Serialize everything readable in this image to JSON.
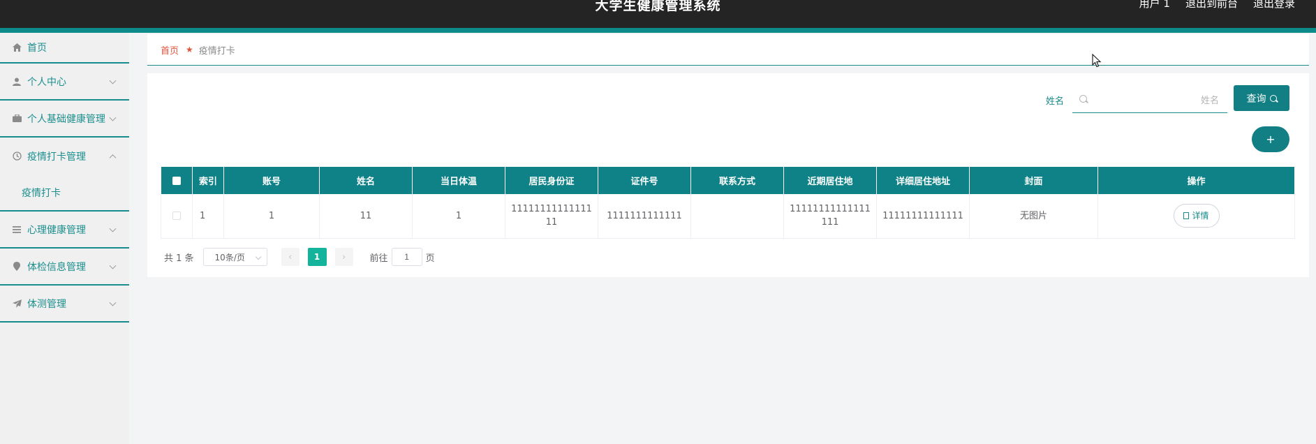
{
  "header": {
    "title": "大学生健康管理系统",
    "user_label": "用户 1",
    "front_link": "退出到前台",
    "logout_link": "退出登录"
  },
  "sidebar": {
    "items": [
      {
        "label": "首页",
        "icon": "home-icon"
      },
      {
        "label": "个人中心",
        "icon": "user-icon"
      },
      {
        "label": "个人基础健康管理",
        "icon": "briefcase-icon"
      },
      {
        "label": "疫情打卡管理",
        "icon": "clock-icon",
        "expanded": true,
        "children": [
          "疫情打卡"
        ]
      },
      {
        "label": "心理健康管理",
        "icon": "list-icon"
      },
      {
        "label": "体检信息管理",
        "icon": "location-icon"
      },
      {
        "label": "体测管理",
        "icon": "send-icon"
      }
    ]
  },
  "breadcrumb": {
    "home": "首页",
    "current": "疫情打卡"
  },
  "search": {
    "label": "姓名",
    "placeholder": "姓名",
    "query_label": "查询",
    "add_label": "+"
  },
  "table": {
    "columns": [
      "索引",
      "账号",
      "姓名",
      "当日体温",
      "居民身份证",
      "证件号",
      "联系方式",
      "近期居住地",
      "详细居住地址",
      "封面",
      "操作"
    ],
    "rows": [
      {
        "index": "1",
        "account": "1",
        "name": "11",
        "temperature": "1",
        "id_card": "1111111111111111",
        "cert_no": "1111111111111",
        "contact": "",
        "recent_residence": "11111111111111111",
        "address": "11111111111111",
        "cover": "无图片",
        "action": "详情"
      }
    ]
  },
  "pagination": {
    "total": "共 1 条",
    "page_size": "10条/页",
    "prev": "‹",
    "current_page": "1",
    "next": "›",
    "goto_label": "前往",
    "goto_value": "1",
    "page_suffix": "页"
  },
  "colors": {
    "topbar": "#242424",
    "accent": "#0e8287",
    "page_active": "#13b39c",
    "breadcrumb_home": "#e0533c"
  }
}
